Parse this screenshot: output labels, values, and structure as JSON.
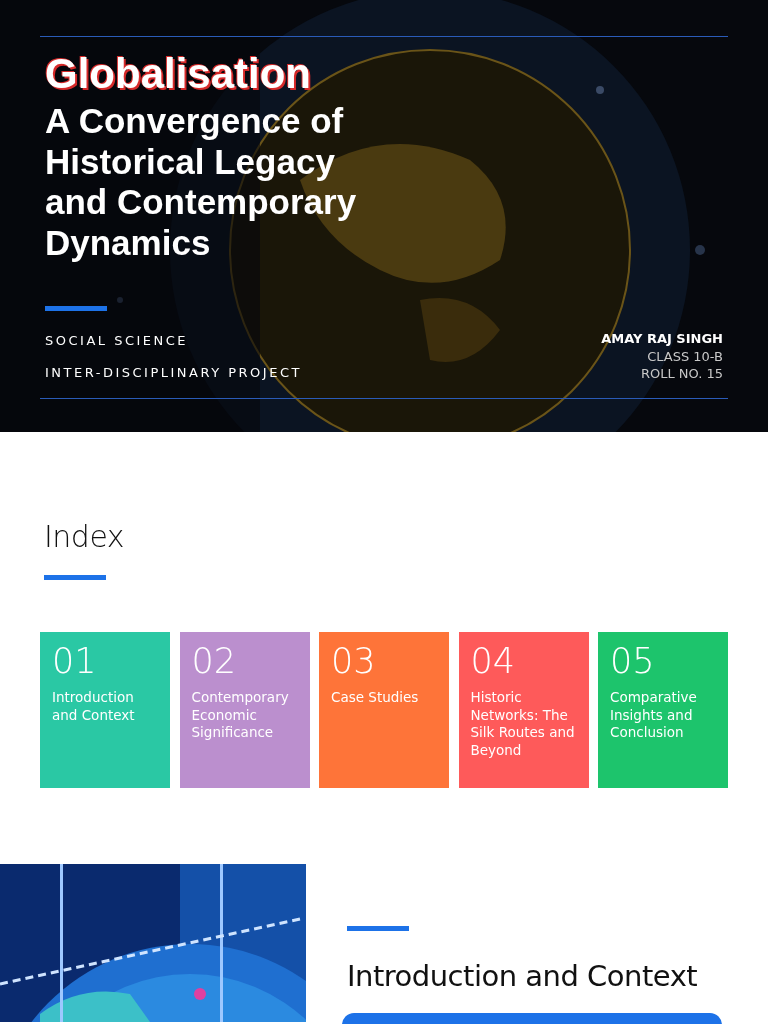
{
  "hero": {
    "title": "Globalisation",
    "subtitle_lines": [
      "A Convergence of",
      "Historical Legacy",
      "and Contemporary",
      "Dynamics"
    ],
    "labels": [
      "SOCIAL SCIENCE",
      "INTER-DISCIPLINARY PROJECT"
    ],
    "author": "AMAY RAJ SINGH",
    "details": [
      "CLASS 10-B",
      "ROLL NO. 15"
    ]
  },
  "index": {
    "heading": "Index",
    "items": [
      {
        "number": "01",
        "label": "Introduction and Context",
        "color": "#2ac8a4"
      },
      {
        "number": "02",
        "label": "Contemporary Economic Significance",
        "color": "#bb8fce"
      },
      {
        "number": "03",
        "label": "Case Studies",
        "color": "#fe7439"
      },
      {
        "number": "04",
        "label": "Historic Networks: The Silk Routes and Beyond",
        "color": "#fe5a5a"
      },
      {
        "number": "05",
        "label": "Comparative Insights and Conclusion",
        "color": "#1dc46c"
      }
    ]
  },
  "section": {
    "heading": "Introduction and Context"
  }
}
